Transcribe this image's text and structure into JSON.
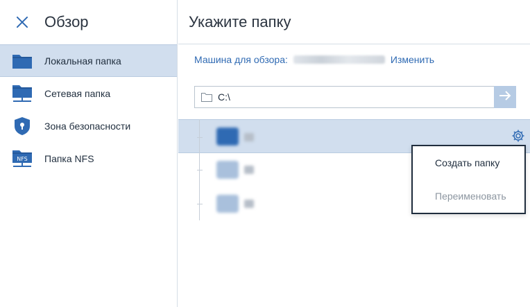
{
  "sidebar": {
    "title": "Обзор",
    "items": [
      {
        "label": "Локальная папка",
        "icon": "folder-icon",
        "active": true
      },
      {
        "label": "Сетевая папка",
        "icon": "network-folder-icon",
        "active": false
      },
      {
        "label": "Зона безопасности",
        "icon": "shield-lock-icon",
        "active": false
      },
      {
        "label": "Папка NFS",
        "icon": "nfs-folder-icon",
        "active": false
      }
    ]
  },
  "main": {
    "title": "Укажите папку",
    "machine_label": "Машина для обзора:",
    "change_link": "Изменить",
    "path_value": "C:\\",
    "go_icon": "arrow-right-icon"
  },
  "context_menu": {
    "items": [
      {
        "label": "Создать папку",
        "enabled": true
      },
      {
        "label": "Переименовать",
        "enabled": false
      }
    ]
  },
  "colors": {
    "accent": "#2f6ab3",
    "selection": "#d1deee",
    "button_disabled": "#b6cbe4"
  }
}
